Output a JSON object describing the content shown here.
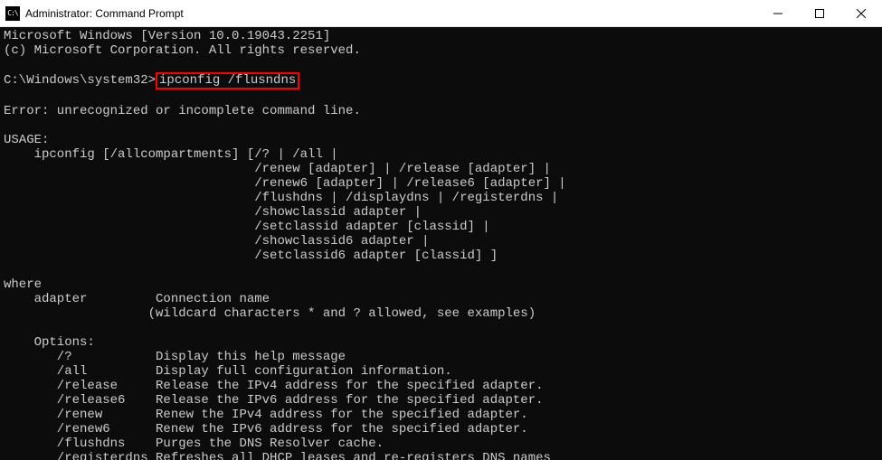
{
  "window": {
    "title": "Administrator: Command Prompt"
  },
  "term": {
    "l1": "Microsoft Windows [Version 10.0.19043.2251]",
    "l2": "(c) Microsoft Corporation. All rights reserved.",
    "prompt": "C:\\Windows\\system32>",
    "cmd": "ipconfig /flusndns",
    "err": "Error: unrecognized or incomplete command line.",
    "usage_h": "USAGE:",
    "u1": "    ipconfig [/allcompartments] [/? | /all |",
    "u2a": "                                 /renew [adapter] | /release [adapter] |",
    "u2b": "                                 /renew6 [adapter] | /release6 [adapter] |",
    "u2c": "                                 /flushdns | /displaydns | /registerdns |",
    "u2d": "                                 /showclassid adapter |",
    "u2e": "                                 /setclassid adapter [classid] |",
    "u2f": "                                 /showclassid6 adapter |",
    "u2g": "                                 /setclassid6 adapter [classid] ]",
    "where_h": "where",
    "w1": "    adapter         Connection name",
    "w2": "                   (wildcard characters * and ? allowed, see examples)",
    "opt_h": "    Options:",
    "o1": "       /?           Display this help message",
    "o2": "       /all         Display full configuration information.",
    "o3": "       /release     Release the IPv4 address for the specified adapter.",
    "o4": "       /release6    Release the IPv6 address for the specified adapter.",
    "o5": "       /renew       Renew the IPv4 address for the specified adapter.",
    "o6": "       /renew6      Renew the IPv6 address for the specified adapter.",
    "o7": "       /flushdns    Purges the DNS Resolver cache.",
    "o8": "       /registerdns Refreshes all DHCP leases and re-registers DNS names"
  }
}
